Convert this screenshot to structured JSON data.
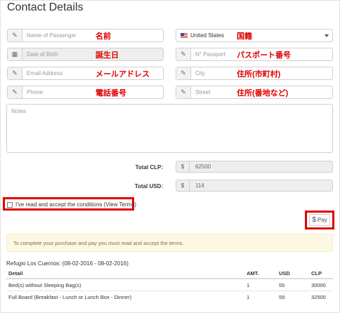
{
  "page_title": "Contact Details",
  "fields": {
    "passenger": {
      "placeholder": "Name of Passenger",
      "annotation": "名前",
      "icon": "pencil-icon"
    },
    "country": {
      "value": "United States",
      "annotation": "国籍",
      "icon": "us-flag-icon"
    },
    "dob": {
      "placeholder": "Date of Birth",
      "annotation": "誕生日",
      "icon": "calendar-icon"
    },
    "passport": {
      "placeholder": "N° Passport",
      "annotation": "パスポート番号",
      "icon": "pencil-icon"
    },
    "email": {
      "placeholder": "Email Address",
      "annotation": "メールアドレス",
      "icon": "pencil-icon"
    },
    "city": {
      "placeholder": "City",
      "annotation": "住所(市町村)",
      "icon": "pencil-icon"
    },
    "phone": {
      "placeholder": "Phone",
      "annotation": "電話番号",
      "icon": "pencil-icon"
    },
    "street": {
      "placeholder": "Street",
      "annotation": "住所(番地など)",
      "icon": "pencil-icon"
    },
    "notes": {
      "placeholder": "Notes"
    }
  },
  "totals": {
    "clp_label": "Total CLP:",
    "clp_prefix": "$",
    "clp_value": "62500",
    "usd_label": "Total USD:",
    "usd_prefix": "$",
    "usd_value": "114"
  },
  "terms": {
    "label": "I've read and accept the conditions (View Terms)"
  },
  "pay_button": {
    "icon": "$",
    "label": "Pay"
  },
  "alert_text": "To complete your purchase and pay you must read and accept the terms.",
  "booking": {
    "title": "Refugio Los Cuernos: (08-02-2016 - 08-02-2016)",
    "columns": [
      "Detail",
      "AMT.",
      "USD",
      "CLP"
    ],
    "rows": [
      [
        "Bed(s) without Sleeping Bag(s)",
        "1",
        "55",
        "30000"
      ],
      [
        "Full Board (Breakfast - Lunch or Lunch Box - Dinner)",
        "1",
        "59",
        "32500"
      ]
    ]
  },
  "colors": {
    "annotation_red": "#e00000",
    "alert_bg": "#fcf8e3",
    "alert_text": "#8a6d3b"
  }
}
